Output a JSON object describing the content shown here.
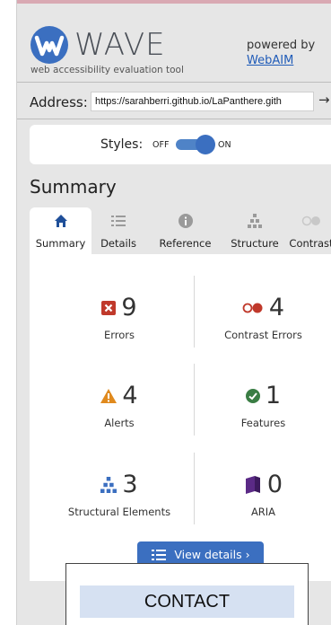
{
  "header": {
    "logo_text": "WAVE",
    "tagline": "web accessibility evaluation tool",
    "powered_by": "powered by",
    "powered_link": "WebAIM"
  },
  "address": {
    "label": "Address:",
    "value": "https://sarahberri.github.io/LaPanthere.gith",
    "go_glyph": "→"
  },
  "styles_toggle": {
    "label": "Styles:",
    "off": "OFF",
    "on": "ON",
    "state": "on"
  },
  "section_title": "Summary",
  "tabs": [
    {
      "label": "Summary",
      "icon": "home-icon",
      "active": true
    },
    {
      "label": "Details",
      "icon": "list-icon",
      "active": false
    },
    {
      "label": "Reference",
      "icon": "info-icon",
      "active": false
    },
    {
      "label": "Structure",
      "icon": "structure-icon",
      "active": false
    },
    {
      "label": "Contrast",
      "icon": "contrast-icon",
      "active": false
    }
  ],
  "stats": {
    "errors": {
      "count": "9",
      "label": "Errors",
      "icon": "error-icon",
      "color": "#c0392b"
    },
    "contrast_errors": {
      "count": "4",
      "label": "Contrast Errors",
      "icon": "contrast-error-icon",
      "color": "#c0392b"
    },
    "alerts": {
      "count": "4",
      "label": "Alerts",
      "icon": "alert-icon",
      "color": "#e08a1e"
    },
    "features": {
      "count": "1",
      "label": "Features",
      "icon": "feature-check-icon",
      "color": "#3a7d44"
    },
    "structural": {
      "count": "3",
      "label": "Structural Elements",
      "icon": "structure-icon",
      "color": "#3b6fc0"
    },
    "aria": {
      "count": "0",
      "label": "ARIA",
      "icon": "aria-icon",
      "color": "#5b2a86"
    }
  },
  "view_details_button": "View details ›",
  "contact_label": "CONTACT",
  "colors": {
    "accent": "#3b6fc0",
    "panel_bg": "#e6e6e6",
    "card_bg": "#ffffff",
    "contact_bg": "#d6e1f2"
  }
}
